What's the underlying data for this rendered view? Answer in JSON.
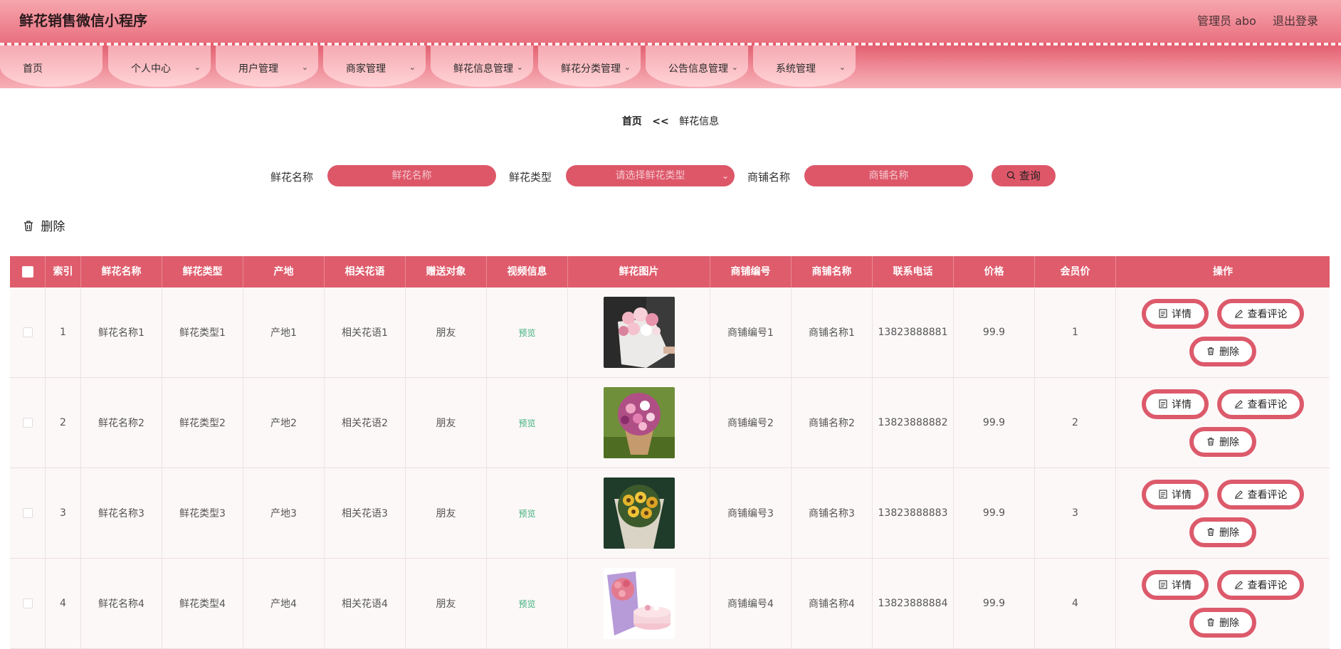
{
  "app": {
    "title": "鲜花销售微信小程序"
  },
  "header": {
    "admin_text": "管理员 abo",
    "logout_label": "退出登录"
  },
  "nav": {
    "items": [
      {
        "label": "首页",
        "dropdown": false
      },
      {
        "label": "个人中心",
        "dropdown": true
      },
      {
        "label": "用户管理",
        "dropdown": true
      },
      {
        "label": "商家管理",
        "dropdown": true
      },
      {
        "label": "鲜花信息管理",
        "dropdown": true
      },
      {
        "label": "鲜花分类管理",
        "dropdown": true
      },
      {
        "label": "公告信息管理",
        "dropdown": true
      },
      {
        "label": "系统管理",
        "dropdown": true
      }
    ]
  },
  "breadcrumb": {
    "home": "首页",
    "separator": "<<",
    "current": "鲜花信息"
  },
  "search": {
    "name_label": "鲜花名称",
    "name_placeholder": "鲜花名称",
    "type_label": "鲜花类型",
    "type_placeholder": "请选择鲜花类型",
    "shop_label": "商铺名称",
    "shop_placeholder": "商铺名称",
    "button_label": "查询"
  },
  "toolbar": {
    "delete_label": "删除"
  },
  "table": {
    "headers": [
      "索引",
      "鲜花名称",
      "鲜花类型",
      "产地",
      "相关花语",
      "赠送对象",
      "视频信息",
      "鲜花图片",
      "商铺编号",
      "商铺名称",
      "联系电话",
      "价格",
      "会员价",
      "操作"
    ],
    "rows": [
      {
        "index": "1",
        "name": "鲜花名称1",
        "type": "鲜花类型1",
        "origin": "产地1",
        "meaning": "相关花语1",
        "recipient": "朋友",
        "video": "预览",
        "shop_no": "商铺编号1",
        "shop_name": "商铺名称1",
        "phone": "13823888881",
        "price": "99.9",
        "member_price": "1"
      },
      {
        "index": "2",
        "name": "鲜花名称2",
        "type": "鲜花类型2",
        "origin": "产地2",
        "meaning": "相关花语2",
        "recipient": "朋友",
        "video": "预览",
        "shop_no": "商铺编号2",
        "shop_name": "商铺名称2",
        "phone": "13823888882",
        "price": "99.9",
        "member_price": "2"
      },
      {
        "index": "3",
        "name": "鲜花名称3",
        "type": "鲜花类型3",
        "origin": "产地3",
        "meaning": "相关花语3",
        "recipient": "朋友",
        "video": "预览",
        "shop_no": "商铺编号3",
        "shop_name": "商铺名称3",
        "phone": "13823888883",
        "price": "99.9",
        "member_price": "3"
      },
      {
        "index": "4",
        "name": "鲜花名称4",
        "type": "鲜花类型4",
        "origin": "产地4",
        "meaning": "相关花语4",
        "recipient": "朋友",
        "video": "预览",
        "shop_no": "商铺编号4",
        "shop_name": "商铺名称4",
        "phone": "13823888884",
        "price": "99.9",
        "member_price": "4"
      }
    ],
    "actions": {
      "detail": "详情",
      "comments": "查看评论",
      "delete": "删除"
    }
  },
  "colors": {
    "accent": "#dd5769",
    "header_top": "#f7a6ad",
    "video_link": "#3db07c"
  }
}
